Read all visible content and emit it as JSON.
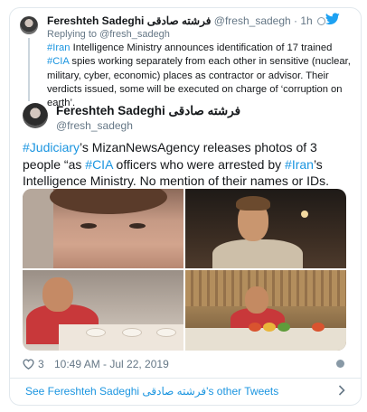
{
  "parent_tweet": {
    "author_name": "Fereshteh Sadeghi فرشته صادقی",
    "handle": "@fresh_sadegh",
    "separator": "·",
    "time": "1h",
    "replying_to": "Replying to @fresh_sadegh",
    "text_parts": [
      {
        "type": "tag",
        "value": "#Iran"
      },
      {
        "type": "text",
        "value": " Intelligence Ministry announces identification of 17 trained "
      },
      {
        "type": "tag",
        "value": "#CIA"
      },
      {
        "type": "text",
        "value": " spies working separately from each other in sensitive (nuclear, military, cyber, economic) places as contractor or advisor. Their verdicts issued, some will be executed on charge of ‘corruption on earth’."
      }
    ]
  },
  "tweet": {
    "author_name": "Fereshteh Sadeghi فرشته صادقی",
    "handle": "@fresh_sadegh",
    "text_parts": [
      {
        "type": "tag",
        "value": "#Judiciary"
      },
      {
        "type": "text",
        "value": "’s MizanNewsAgency releases photos of 3 people “as "
      },
      {
        "type": "tag",
        "value": "#CIA"
      },
      {
        "type": "text",
        "value": " officers who were arrested by "
      },
      {
        "type": "tag",
        "value": "#Iran"
      },
      {
        "type": "text",
        "value": "’s Intelligence Ministry. No mention of their names or IDs."
      }
    ],
    "likes": "3",
    "timestamp": "10:49 AM - Jul 22, 2019"
  },
  "footer": {
    "see_more_label": "See Fereshteh Sadeghi فرشته صادقی's other Tweets"
  },
  "colors": {
    "link": "#1b95e0",
    "muted": "#657786",
    "border": "#e1e8ed"
  },
  "icons": {
    "brand": "twitter-bird-icon",
    "like": "heart-icon",
    "info": "info-circle-icon",
    "more": "chevron-right-icon"
  }
}
